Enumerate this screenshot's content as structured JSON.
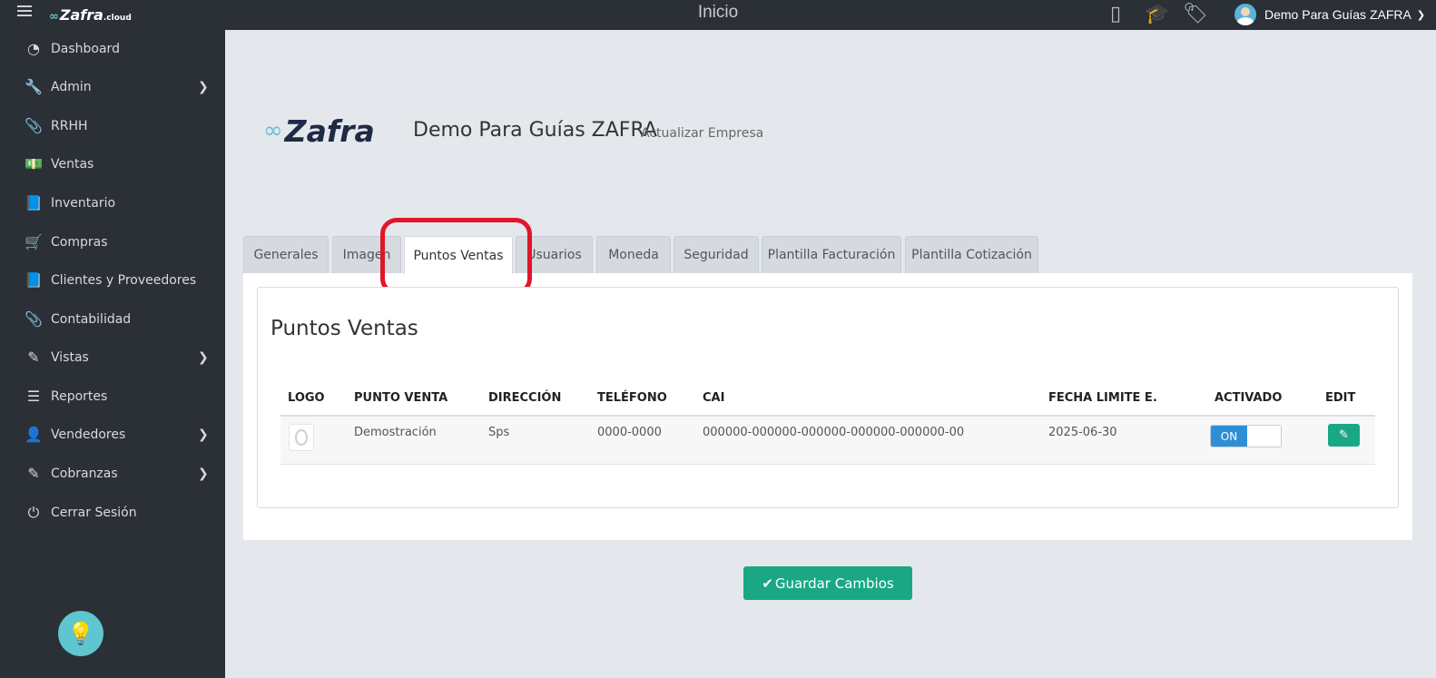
{
  "topbar": {
    "brand": "Zafra",
    "brand_suffix": ".cloud",
    "title": "Inicio",
    "icons": [
      "mobile-icon",
      "graduation-cap-icon",
      "tags-icon"
    ],
    "user_name": "Demo Para Guías ZAFRA"
  },
  "sidebar": {
    "items": [
      {
        "label": "Dashboard",
        "icon": "dashboard-icon",
        "has_submenu": false
      },
      {
        "label": "Admin",
        "icon": "wrench-icon",
        "has_submenu": true
      },
      {
        "label": "RRHH",
        "icon": "paperclip-icon",
        "has_submenu": false
      },
      {
        "label": "Ventas",
        "icon": "money-icon",
        "has_submenu": false
      },
      {
        "label": "Inventario",
        "icon": "book-icon",
        "has_submenu": false
      },
      {
        "label": "Compras",
        "icon": "cart-icon",
        "has_submenu": false
      },
      {
        "label": "Clientes y Proveedores",
        "icon": "book-icon",
        "has_submenu": false
      },
      {
        "label": "Contabilidad",
        "icon": "paperclip-icon",
        "has_submenu": false
      },
      {
        "label": "Vistas",
        "icon": "edit-icon",
        "has_submenu": true
      },
      {
        "label": "Reportes",
        "icon": "list-icon",
        "has_submenu": false
      },
      {
        "label": "Vendedores",
        "icon": "user-icon",
        "has_submenu": true
      },
      {
        "label": "Cobranzas",
        "icon": "edit-icon",
        "has_submenu": true
      },
      {
        "label": "Cerrar Sesión",
        "icon": "power-icon",
        "has_submenu": false
      }
    ]
  },
  "header": {
    "logo_text": "Zafra",
    "company_name": "Demo Para Guías ZAFRA",
    "subtitle": "Actualizar Empresa"
  },
  "tabs": [
    {
      "label": "Generales",
      "active": false
    },
    {
      "label": "Imagen",
      "active": false
    },
    {
      "label": "Puntos Ventas",
      "active": true
    },
    {
      "label": "Usuarios",
      "active": false
    },
    {
      "label": "Moneda",
      "active": false
    },
    {
      "label": "Seguridad",
      "active": false
    },
    {
      "label": "Plantilla Facturación",
      "active": false
    },
    {
      "label": "Plantilla Cotización",
      "active": false
    }
  ],
  "section": {
    "title": "Puntos Ventas",
    "columns": [
      "LOGO",
      "PUNTO VENTA",
      "DIRECCIÓN",
      "TELÉFONO",
      "CAI",
      "FECHA LIMITE E.",
      "ACTIVADO",
      "EDIT"
    ],
    "rows": [
      {
        "punto_venta": "Demostración",
        "direccion": "Sps",
        "telefono": "0000-0000",
        "cai": "000000-000000-000000-000000-000000-00",
        "fecha_limite": "2025-06-30",
        "activado": "ON"
      }
    ]
  },
  "actions": {
    "save_label": "Guardar Cambios"
  },
  "colors": {
    "sidebar_bg": "#2b2f36",
    "accent_green": "#1aa884",
    "toggle_blue": "#2f8fd6",
    "highlight_red": "#e0162b",
    "brand_teal": "#62c4d1"
  }
}
